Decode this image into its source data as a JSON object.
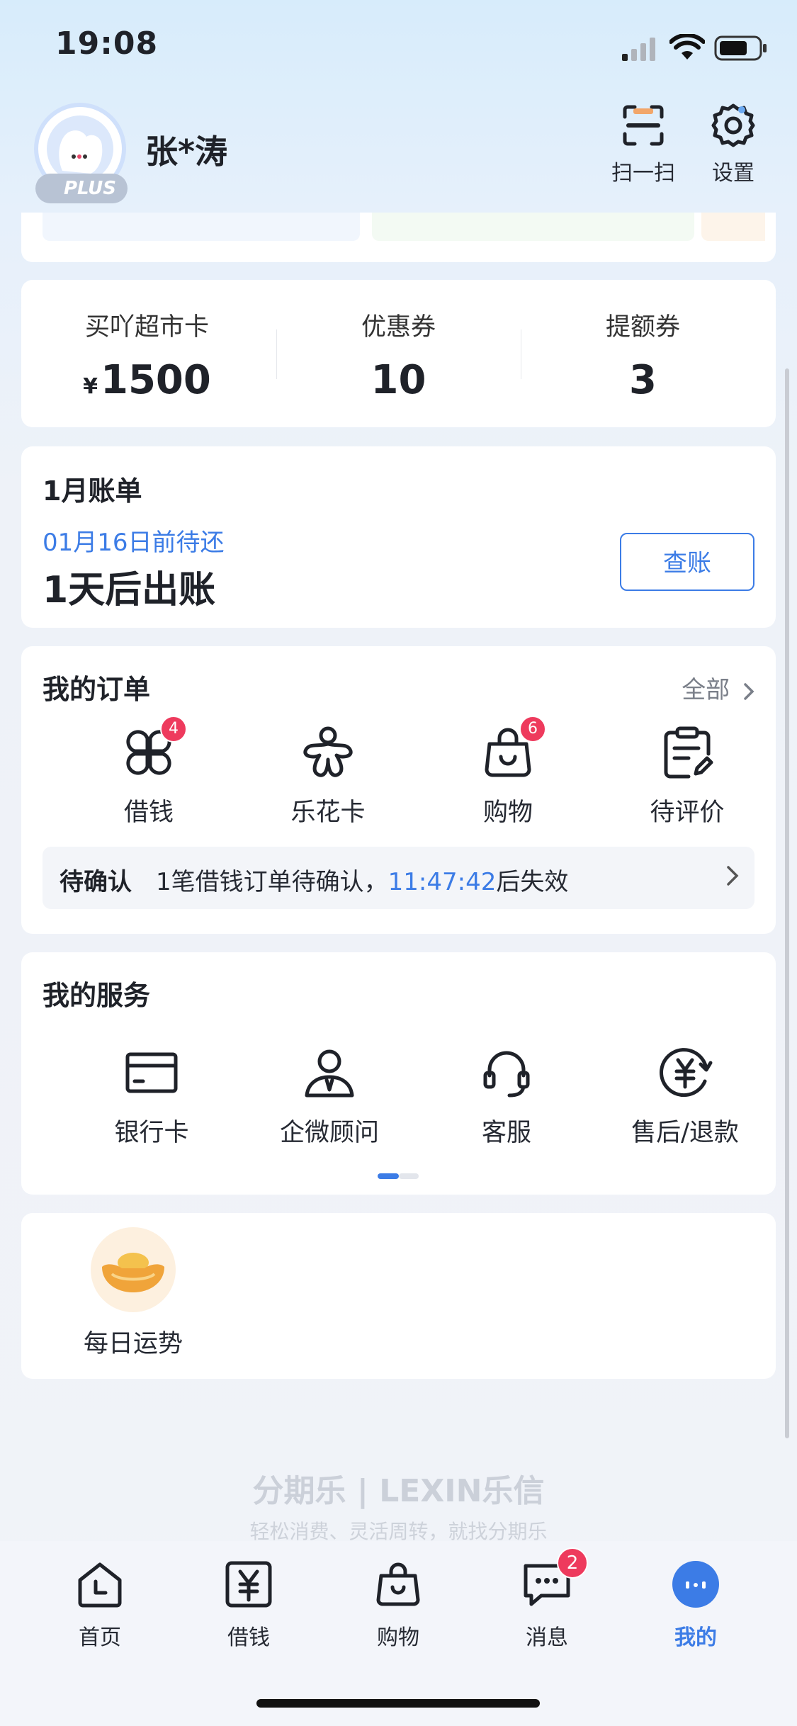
{
  "status_bar": {
    "time": "19:08"
  },
  "header": {
    "username": "张*涛",
    "plus_label": "PLUS",
    "scan_label": "扫一扫",
    "settings_label": "设置"
  },
  "stats": [
    {
      "label": "买吖超市卡",
      "currency": "¥",
      "value": "1500"
    },
    {
      "label": "优惠券",
      "value": "10"
    },
    {
      "label": "提额券",
      "value": "3"
    }
  ],
  "bill": {
    "title": "1月账单",
    "due": "01月16日前待还",
    "status": "1天后出账",
    "button": "查账"
  },
  "orders": {
    "title": "我的订单",
    "all_link": "全部",
    "items": [
      {
        "label": "借钱",
        "icon": "clover-icon",
        "badge": "4"
      },
      {
        "label": "乐花卡",
        "icon": "flower-icon",
        "badge": ""
      },
      {
        "label": "购物",
        "icon": "shopping-bag-icon",
        "badge": "6"
      },
      {
        "label": "待评价",
        "icon": "clipboard-edit-icon",
        "badge": ""
      }
    ],
    "notice": {
      "tag": "待确认",
      "message_prefix": "1笔借钱订单待确认，",
      "countdown": "11:47:42",
      "message_suffix": "后失效"
    }
  },
  "services": {
    "title": "我的服务",
    "items": [
      {
        "label": "银行卡",
        "icon": "bank-card-icon"
      },
      {
        "label": "企微顾问",
        "icon": "advisor-icon"
      },
      {
        "label": "客服",
        "icon": "headset-icon"
      },
      {
        "label": "售后/退款",
        "icon": "refund-icon"
      }
    ]
  },
  "fortune": {
    "label": "每日运势",
    "icon": "gold-ingot-icon"
  },
  "footer": {
    "logo": "分期乐 | LEXIN乐信",
    "slogan": "轻松消费、灵活周转，就找分期乐"
  },
  "tabbar": {
    "items": [
      {
        "label": "首页",
        "icon": "home-clock-icon"
      },
      {
        "label": "借钱",
        "icon": "yen-icon"
      },
      {
        "label": "购物",
        "icon": "shopping-bag-icon"
      },
      {
        "label": "消息",
        "icon": "message-icon",
        "badge": "2"
      },
      {
        "label": "我的",
        "icon": "profile-icon"
      }
    ]
  },
  "colors": {
    "accent": "#3c7ce6",
    "badge": "#ee3a5d",
    "text": "#1f2229"
  }
}
